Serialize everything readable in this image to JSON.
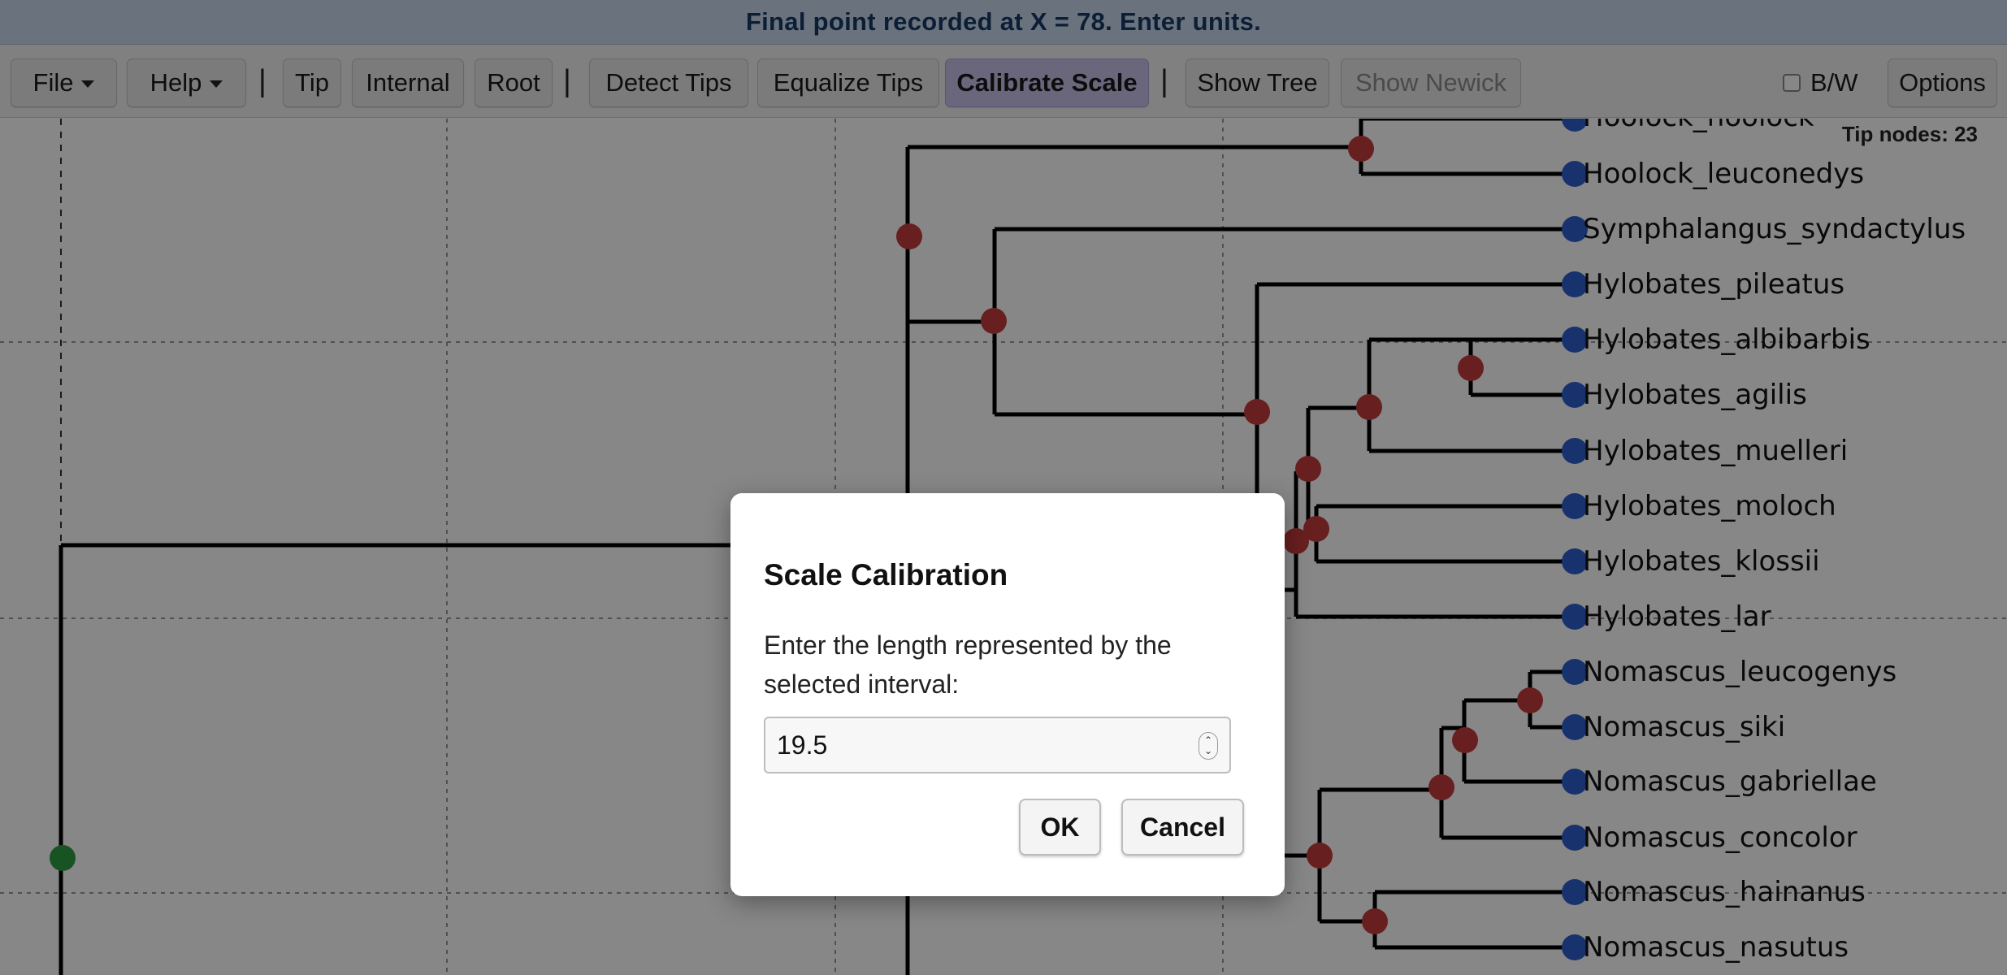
{
  "status": {
    "message": "Final point recorded at X = 78. Enter units."
  },
  "toolbar": {
    "file_label": "File",
    "help_label": "Help",
    "separator": "|",
    "tip_label": "Tip",
    "internal_label": "Internal",
    "root_label": "Root",
    "detect_tips_label": "Detect Tips",
    "equalize_tips_label": "Equalize Tips",
    "calibrate_scale_label": "Calibrate Scale",
    "show_tree_label": "Show Tree",
    "show_newick_label": "Show Newick",
    "bw_label": "B/W",
    "options_label": "Options"
  },
  "canvas": {
    "tip_count_text": "Tip nodes: 23",
    "tips": [
      "Hoolock_hoolock",
      "Hoolock_leuconedys",
      "Symphalangus_syndactylus",
      "Hylobates_pileatus",
      "Hylobates_albibarbis",
      "Hylobates_agilis",
      "Hylobates_muelleri",
      "Hylobates_moloch",
      "Hylobates_klossii",
      "Hylobates_lar",
      "Nomascus_leucogenys",
      "Nomascus_siki",
      "Nomascus_gabriellae",
      "Nomascus_concolor",
      "Nomascus_hainanus",
      "Nomascus_nasutus"
    ],
    "colors": {
      "tip_node": "#2f5fd0",
      "internal_node": "#c43b3b",
      "root_node": "#2e9e44",
      "branch": "#000000",
      "grid": "#9a9a9a"
    }
  },
  "dialog": {
    "title": "Scale Calibration",
    "message": "Enter the length represented by the selected interval:",
    "input_value": "19.5",
    "ok_label": "OK",
    "cancel_label": "Cancel"
  }
}
